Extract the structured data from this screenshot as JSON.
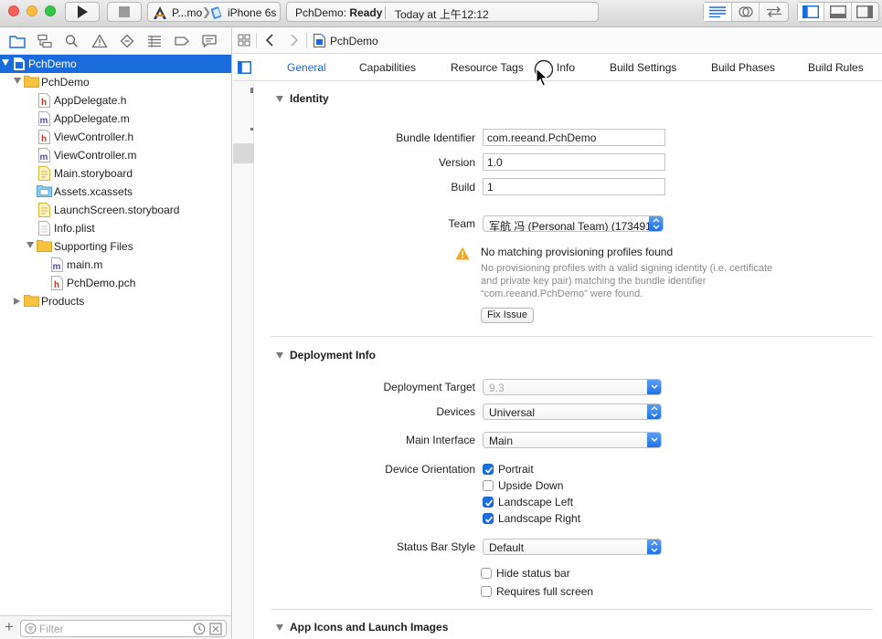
{
  "toolbar": {
    "scheme_project": "P...mo",
    "scheme_device": "iPhone 6s",
    "activity_project": "PchDemo:",
    "activity_status": "Ready",
    "activity_time": "Today at 上午12:12"
  },
  "navigator": {
    "items": [
      {
        "label": "PchDemo",
        "type": "project",
        "indent": 0,
        "disclosure": "open",
        "selected": true
      },
      {
        "label": "PchDemo",
        "type": "folder",
        "indent": 1,
        "disclosure": "open"
      },
      {
        "label": "AppDelegate.h",
        "type": "h-file",
        "indent": 2
      },
      {
        "label": "AppDelegate.m",
        "type": "m-file",
        "indent": 2
      },
      {
        "label": "ViewController.h",
        "type": "h-file",
        "indent": 2
      },
      {
        "label": "ViewController.m",
        "type": "m-file",
        "indent": 2
      },
      {
        "label": "Main.storyboard",
        "type": "storyboard",
        "indent": 2
      },
      {
        "label": "Assets.xcassets",
        "type": "assets",
        "indent": 2
      },
      {
        "label": "LaunchScreen.storyboard",
        "type": "storyboard",
        "indent": 2
      },
      {
        "label": "Info.plist",
        "type": "plist",
        "indent": 2
      },
      {
        "label": "Supporting Files",
        "type": "folder",
        "indent": 2,
        "disclosure": "open"
      },
      {
        "label": "main.m",
        "type": "m-file",
        "indent": 3
      },
      {
        "label": "PchDemo.pch",
        "type": "h-file",
        "indent": 3
      },
      {
        "label": "Products",
        "type": "folder",
        "indent": 1,
        "disclosure": "closed"
      }
    ],
    "filter_placeholder": "Filter"
  },
  "jumpbar": {
    "crumb": "PchDemo"
  },
  "tabs": [
    "General",
    "Capabilities",
    "Resource Tags",
    "Info",
    "Build Settings",
    "Build Phases",
    "Build Rules"
  ],
  "identity": {
    "title": "Identity",
    "bundle_identifier_label": "Bundle Identifier",
    "bundle_identifier": "com.reeand.PchDemo",
    "version_label": "Version",
    "version": "1.0",
    "build_label": "Build",
    "build": "1",
    "team_label": "Team",
    "team": "军航 冯 (Personal Team) (173491...",
    "warning_title": "No matching provisioning profiles found",
    "warning_body": "No provisioning profiles with a valid signing identity (i.e. certificate and private key pair) matching the bundle identifier “com.reeand.PchDemo” were found.",
    "fix_issue": "Fix Issue"
  },
  "deployment": {
    "title": "Deployment Info",
    "target_label": "Deployment Target",
    "target": "9.3",
    "devices_label": "Devices",
    "devices": "Universal",
    "main_interface_label": "Main Interface",
    "main_interface": "Main",
    "orientation_label": "Device Orientation",
    "portrait": "Portrait",
    "upside_down": "Upside Down",
    "landscape_left": "Landscape Left",
    "landscape_right": "Landscape Right",
    "status_bar_style_label": "Status Bar Style",
    "status_bar_style": "Default",
    "hide_status_bar": "Hide status bar",
    "requires_full_screen": "Requires full screen"
  },
  "app_icons": {
    "title": "App Icons and Launch Images"
  },
  "colors": {
    "accent": "#1a6bdb",
    "warning": "#f5a623"
  }
}
